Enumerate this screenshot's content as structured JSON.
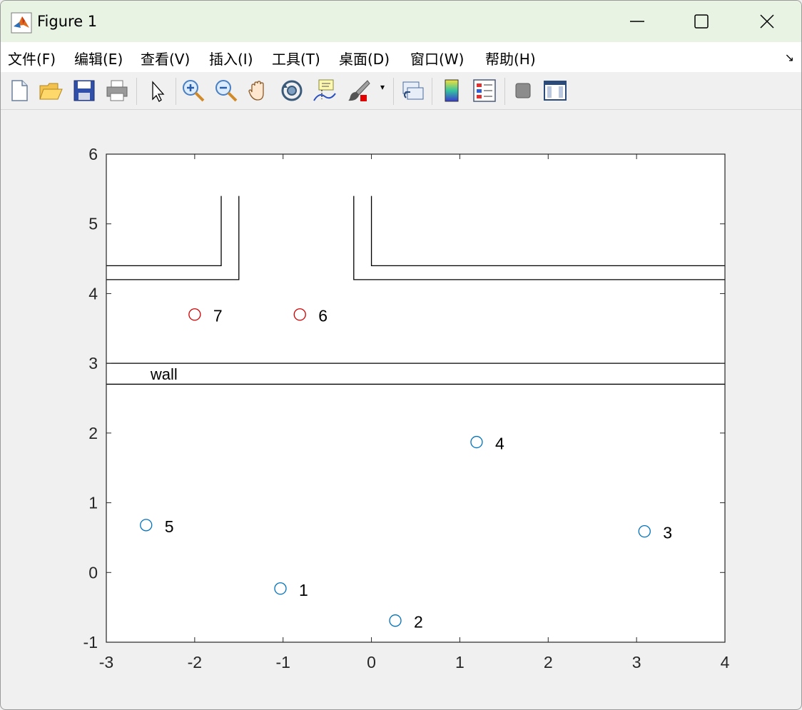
{
  "window": {
    "title": "Figure 1",
    "icon": "matlab-icon",
    "controls": [
      "minimize-icon",
      "maximize-icon",
      "close-icon"
    ]
  },
  "menu": {
    "items": [
      "文件(F)",
      "编辑(E)",
      "查看(V)",
      "插入(I)",
      "工具(T)",
      "桌面(D)",
      "窗口(W)",
      "帮助(H)"
    ],
    "dock_icon": "dock-arrow-icon"
  },
  "toolbar": {
    "buttons": [
      "new-figure-icon",
      "open-file-icon",
      "save-icon",
      "print-icon",
      "edit-plot-icon",
      "zoom-in-icon",
      "zoom-out-icon",
      "pan-icon",
      "rotate-3d-icon",
      "data-cursor-icon",
      "brush-icon",
      "link-plot-icon",
      "colorbar-icon",
      "legend-icon",
      "hide-plot-tools-icon",
      "show-plot-tools-icon"
    ]
  },
  "chart_data": {
    "type": "scatter",
    "title": "",
    "xlabel": "",
    "ylabel": "",
    "xlim": [
      -3,
      4
    ],
    "ylim": [
      -1,
      6
    ],
    "xticks": [
      "-3",
      "-2",
      "-1",
      "0",
      "1",
      "2",
      "3",
      "4"
    ],
    "yticks": [
      "-1",
      "0",
      "1",
      "2",
      "3",
      "4",
      "5",
      "6"
    ],
    "grid": false,
    "series": [
      {
        "color": "#0072bd",
        "marker": "circle",
        "points": [
          {
            "label": "1",
            "x": -1.03,
            "y": -0.23
          },
          {
            "label": "2",
            "x": 0.27,
            "y": -0.69
          },
          {
            "label": "3",
            "x": 3.09,
            "y": 0.59
          },
          {
            "label": "4",
            "x": 1.19,
            "y": 1.87
          },
          {
            "label": "5",
            "x": -2.55,
            "y": 0.68
          }
        ]
      },
      {
        "color": "#d00000",
        "marker": "circle",
        "points": [
          {
            "label": "6",
            "x": -0.81,
            "y": 3.7
          },
          {
            "label": "7",
            "x": -2.0,
            "y": 3.7
          }
        ]
      }
    ],
    "annotations": [
      {
        "text": "wall",
        "x": -2.5,
        "y": 2.85
      }
    ],
    "lines": [
      {
        "x": [
          -3,
          4
        ],
        "y": [
          3.0,
          3.0
        ]
      },
      {
        "x": [
          -3,
          4
        ],
        "y": [
          2.7,
          2.7
        ]
      },
      {
        "x": [
          -3,
          -1.7,
          -1.7
        ],
        "y": [
          4.4,
          4.4,
          5.4
        ]
      },
      {
        "x": [
          -3,
          -1.5,
          -1.5
        ],
        "y": [
          4.2,
          4.2,
          5.4
        ]
      },
      {
        "x": [
          -0.2,
          -0.2,
          4
        ],
        "y": [
          5.4,
          4.2,
          4.2
        ]
      },
      {
        "x": [
          0.0,
          0.0,
          4
        ],
        "y": [
          5.4,
          4.4,
          4.4
        ]
      }
    ],
    "line_color": "#000000"
  }
}
